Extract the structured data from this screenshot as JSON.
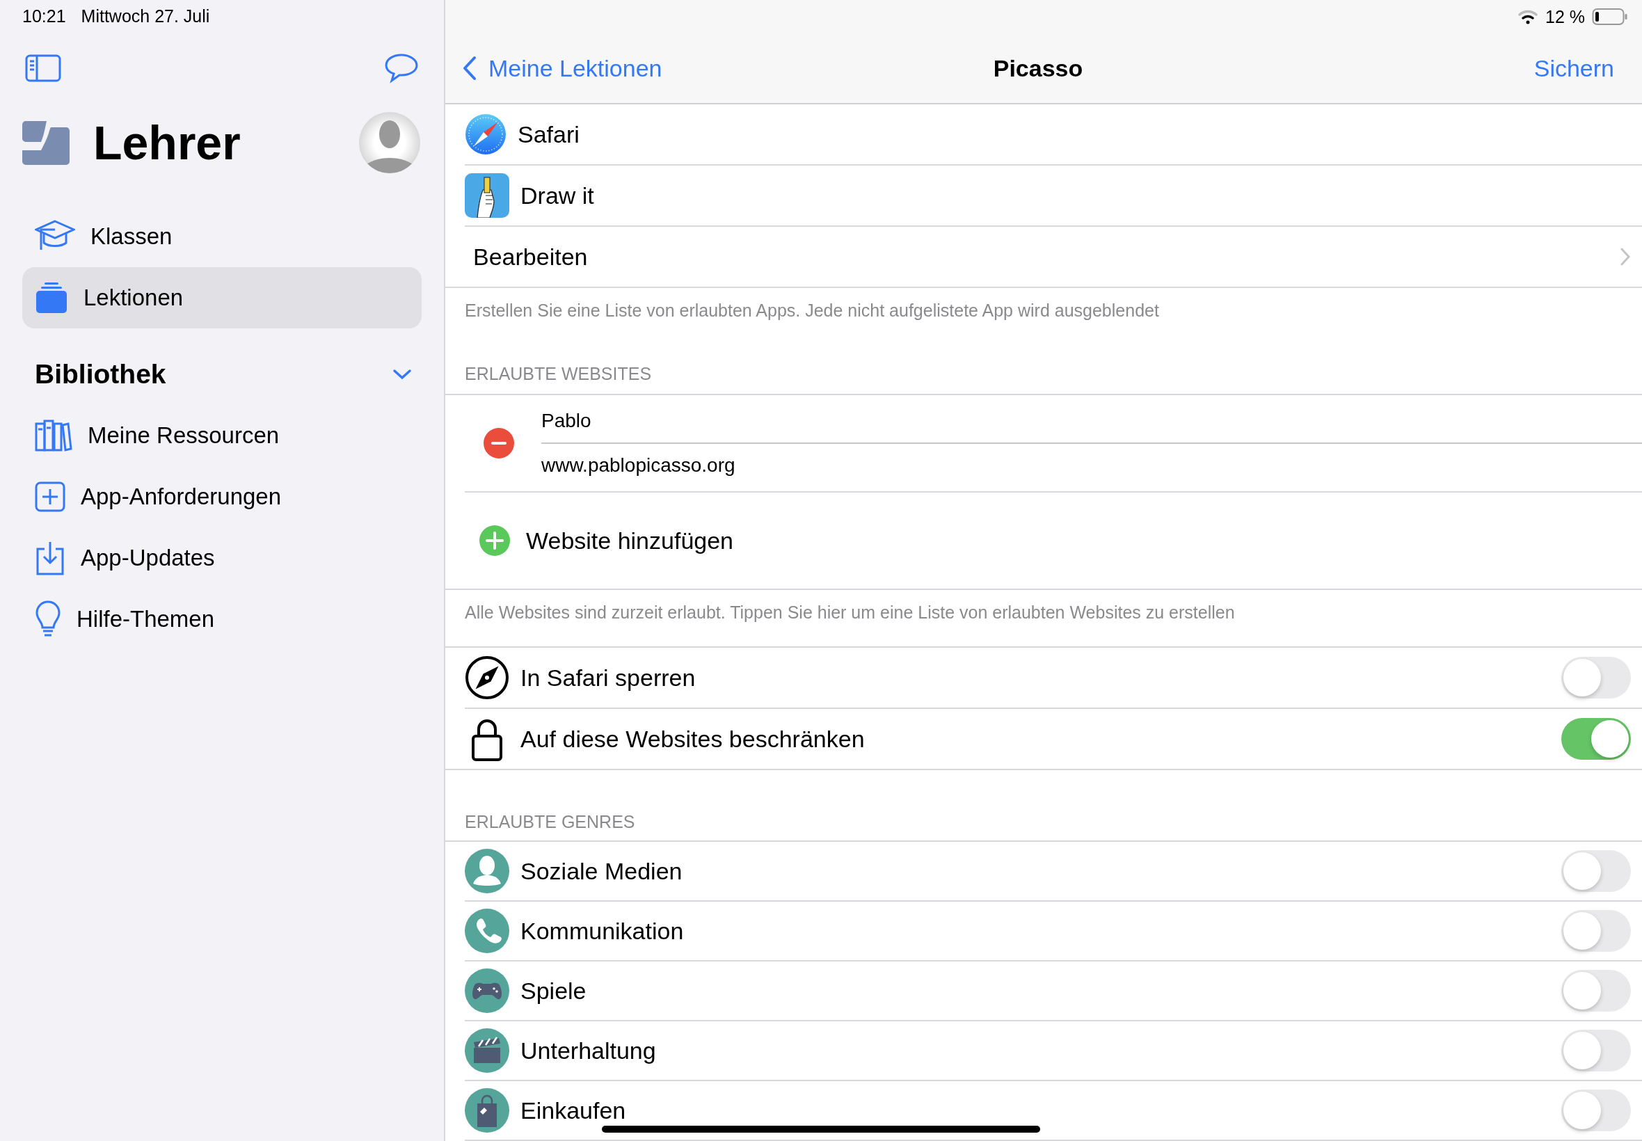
{
  "status_bar": {
    "time": "10:21",
    "date": "Mittwoch 27. Juli",
    "battery": "12 %"
  },
  "sidebar": {
    "title": "Lehrer",
    "nav_items": [
      {
        "label": "Klassen",
        "selected": false
      },
      {
        "label": "Lektionen",
        "selected": true
      }
    ],
    "library": {
      "title": "Bibliothek",
      "expanded": true,
      "items": [
        {
          "label": "Meine Ressourcen"
        },
        {
          "label": "App-Anforderungen"
        },
        {
          "label": "App-Updates"
        },
        {
          "label": "Hilfe-Themen"
        }
      ]
    }
  },
  "nav_bar": {
    "back": "Meine Lektionen",
    "title": "Picasso",
    "action": "Sichern"
  },
  "apps": {
    "items": [
      {
        "name": "Safari"
      },
      {
        "name": "Draw it"
      }
    ],
    "edit": "Bearbeiten",
    "footer": "Erstellen Sie eine Liste von erlaubten Apps. Jede nicht aufgelistete App wird ausgeblendet"
  },
  "websites": {
    "header": "ERLAUBTE WEBSITES",
    "entries": [
      {
        "title": "Pablo",
        "url": "www.pablopicasso.org"
      }
    ],
    "add": "Website hinzufügen",
    "footer": "Alle Websites sind zurzeit erlaubt. Tippen Sie hier um eine Liste von erlaubten Websites zu erstellen"
  },
  "restrictions": [
    {
      "label": "In Safari sperren",
      "on": false
    },
    {
      "label": "Auf diese Websites beschränken",
      "on": true
    }
  ],
  "genres": {
    "header": "ERLAUBTE GENRES",
    "items": [
      {
        "label": "Soziale Medien",
        "on": false
      },
      {
        "label": "Kommunikation",
        "on": false
      },
      {
        "label": "Spiele",
        "on": false
      },
      {
        "label": "Unterhaltung",
        "on": false
      },
      {
        "label": "Einkaufen",
        "on": false
      }
    ]
  }
}
